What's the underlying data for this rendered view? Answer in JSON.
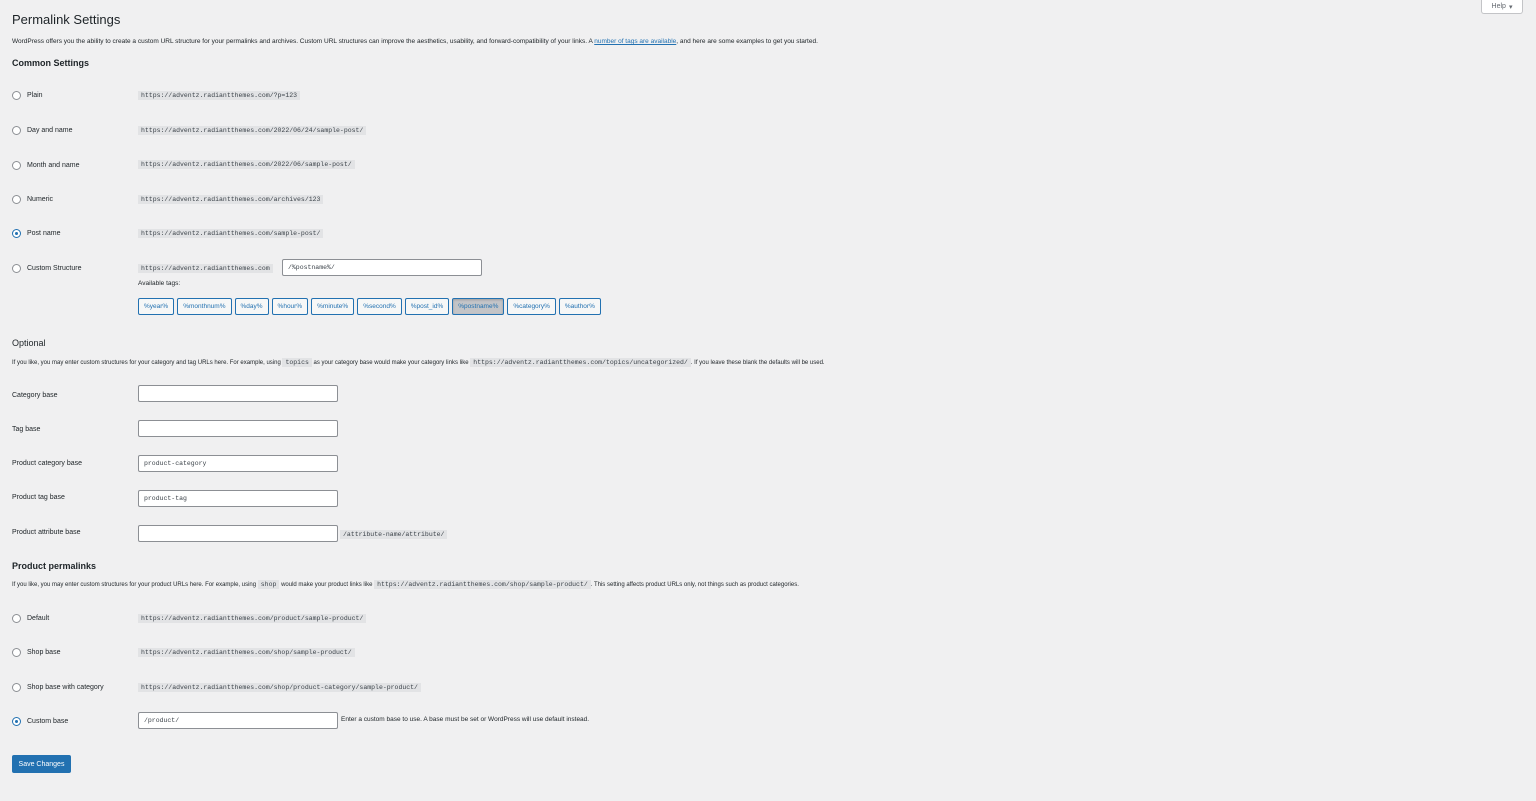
{
  "header": {
    "title": "Permalink Settings",
    "help_label": "Help",
    "help_icon": "caret-down-icon"
  },
  "intro": {
    "text_before": "WordPress offers you the ability to create a custom URL structure for your permalinks and archives. Custom URL structures can improve the aesthetics, usability, and forward-compatibility of your links. A ",
    "link_text": "number of tags are available",
    "text_after": ", and here are some examples to get you started."
  },
  "common": {
    "heading": "Common Settings",
    "options": [
      {
        "label": "Plain",
        "example": "https://adventz.radiantthemes.com/?p=123",
        "checked": false
      },
      {
        "label": "Day and name",
        "example": "https://adventz.radiantthemes.com/2022/06/24/sample-post/",
        "checked": false
      },
      {
        "label": "Month and name",
        "example": "https://adventz.radiantthemes.com/2022/06/sample-post/",
        "checked": false
      },
      {
        "label": "Numeric",
        "example": "https://adventz.radiantthemes.com/archives/123",
        "checked": false
      },
      {
        "label": "Post name",
        "example": "https://adventz.radiantthemes.com/sample-post/",
        "checked": true
      },
      {
        "label": "Custom Structure",
        "example": "https://adventz.radiantthemes.com",
        "checked": false
      }
    ],
    "custom_structure_value": "/%postname%/",
    "available_tags_label": "Available tags:",
    "tags": [
      "%year%",
      "%monthnum%",
      "%day%",
      "%hour%",
      "%minute%",
      "%second%",
      "%post_id%",
      "%postname%",
      "%category%",
      "%author%"
    ],
    "active_tag": "%postname%"
  },
  "optional": {
    "heading": "Optional",
    "desc_1": "If you like, you may enter custom structures for your category and tag URLs here. For example, using",
    "desc_code_1": "topics",
    "desc_2": "as your category base would make your category links like",
    "desc_code_2": "https://adventz.radiantthemes.com/topics/uncategorized/",
    "desc_3": ". If you leave these blank the defaults will be used.",
    "fields": {
      "category_base_label": "Category base",
      "category_base_value": "",
      "tag_base_label": "Tag base",
      "tag_base_value": "",
      "product_category_base_label": "Product category base",
      "product_category_base_value": "product-category",
      "product_tag_base_label": "Product tag base",
      "product_tag_base_value": "product-tag",
      "product_attribute_base_label": "Product attribute base",
      "product_attribute_base_value": "",
      "product_attribute_suffix": "/attribute-name/attribute/"
    }
  },
  "product_permalinks": {
    "heading": "Product permalinks",
    "desc_1": "If you like, you may enter custom structures for your product URLs here. For example, using",
    "desc_code_1": "shop",
    "desc_2": "would make your product links like",
    "desc_code_2": "https://adventz.radiantthemes.com/shop/sample-product/",
    "desc_3": ". This setting affects product URLs only, not things such as product categories.",
    "options": [
      {
        "label": "Default",
        "example": "https://adventz.radiantthemes.com/product/sample-product/",
        "checked": false
      },
      {
        "label": "Shop base",
        "example": "https://adventz.radiantthemes.com/shop/sample-product/",
        "checked": false
      },
      {
        "label": "Shop base with category",
        "example": "https://adventz.radiantthemes.com/shop/product-category/sample-product/",
        "checked": false
      },
      {
        "label": "Custom base",
        "example": "",
        "checked": true
      }
    ],
    "custom_base_value": "/product/",
    "custom_base_note": "Enter a custom base to use. A base must be set or WordPress will use default instead."
  },
  "footer": {
    "save_label": "Save Changes"
  },
  "colors": {
    "accent": "#2271b1",
    "background": "#f0f0f1",
    "text": "#1d2327"
  }
}
